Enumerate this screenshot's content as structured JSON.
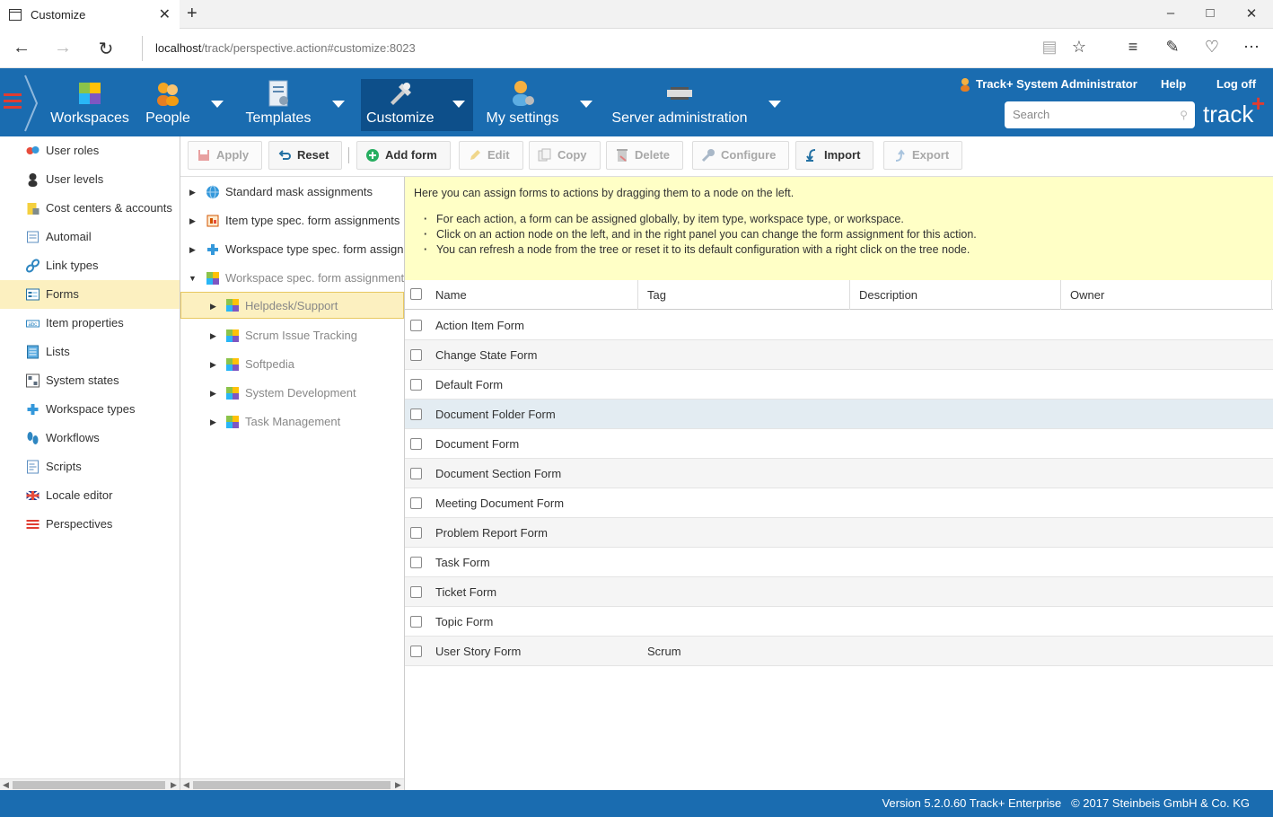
{
  "browser": {
    "tab_title": "Customize",
    "url_host": "localhost",
    "url_path": "/track/perspective.action#customize:8023",
    "new_tab_glyph": "+",
    "close_glyph": "✕"
  },
  "header": {
    "nav": [
      {
        "label": "Workspaces",
        "icon": "workspaces-icon"
      },
      {
        "label": "People",
        "icon": "people-icon"
      },
      {
        "label": "Templates",
        "icon": "templates-icon"
      },
      {
        "label": "Customize",
        "icon": "customize-icon"
      },
      {
        "label": "My settings",
        "icon": "my-settings-icon"
      },
      {
        "label": "Server administration",
        "icon": "server-admin-icon"
      }
    ],
    "user": "Track+ System Administrator",
    "help": "Help",
    "logoff": "Log off",
    "search_placeholder": "Search",
    "logo": "track",
    "logo_plus": "+"
  },
  "sidebar": {
    "items": [
      {
        "label": "User roles",
        "icon": "user-roles-icon",
        "active": false
      },
      {
        "label": "User levels",
        "icon": "user-levels-icon",
        "active": false
      },
      {
        "label": "Cost centers & accounts",
        "icon": "cost-centers-icon",
        "active": false
      },
      {
        "label": "Automail",
        "icon": "automail-icon",
        "active": false
      },
      {
        "label": "Link types",
        "icon": "link-types-icon",
        "active": false
      },
      {
        "label": "Forms",
        "icon": "forms-icon",
        "active": true
      },
      {
        "label": "Item properties",
        "icon": "item-properties-icon",
        "active": false
      },
      {
        "label": "Lists",
        "icon": "lists-icon",
        "active": false
      },
      {
        "label": "System states",
        "icon": "system-states-icon",
        "active": false
      },
      {
        "label": "Workspace types",
        "icon": "workspace-types-icon",
        "active": false
      },
      {
        "label": "Workflows",
        "icon": "workflows-icon",
        "active": false
      },
      {
        "label": "Scripts",
        "icon": "scripts-icon",
        "active": false
      },
      {
        "label": "Locale editor",
        "icon": "locale-editor-icon",
        "active": false
      },
      {
        "label": "Perspectives",
        "icon": "perspectives-icon",
        "active": false
      }
    ]
  },
  "toolbar": {
    "apply": "Apply",
    "reset": "Reset",
    "add_form": "Add form",
    "edit": "Edit",
    "copy": "Copy",
    "delete": "Delete",
    "configure": "Configure",
    "import": "Import",
    "export": "Export"
  },
  "tree": {
    "nodes": [
      {
        "label": "Standard mask assignments",
        "level": 0,
        "expanded": false
      },
      {
        "label": "Item type spec. form assignments",
        "level": 0,
        "expanded": false
      },
      {
        "label": "Workspace type spec. form assignments",
        "level": 0,
        "expanded": false
      },
      {
        "label": "Workspace spec. form assignments",
        "level": 0,
        "expanded": true
      },
      {
        "label": "Helpdesk/Support",
        "level": 1,
        "selected": true
      },
      {
        "label": "Scrum Issue Tracking",
        "level": 1
      },
      {
        "label": "Softpedia",
        "level": 1
      },
      {
        "label": "System Development",
        "level": 1
      },
      {
        "label": "Task Management",
        "level": 1
      }
    ]
  },
  "info": {
    "intro": "Here you can assign forms to actions by dragging them to a node on the left.",
    "bullets": [
      "For each action, a form can be assigned globally, by item type, workspace type, or workspace.",
      "Click on an action node on the left, and in the right panel you can change the form assignment for this action.",
      "You can refresh a node from the tree or reset it to its default configuration with a right click on the tree node."
    ]
  },
  "grid": {
    "columns": [
      "Name",
      "Tag",
      "Description",
      "Owner"
    ],
    "rows": [
      {
        "name": "Action Item Form",
        "tag": ""
      },
      {
        "name": "Change State Form",
        "tag": ""
      },
      {
        "name": "Default Form",
        "tag": ""
      },
      {
        "name": "Document Folder Form",
        "tag": ""
      },
      {
        "name": "Document Form",
        "tag": ""
      },
      {
        "name": "Document Section Form",
        "tag": ""
      },
      {
        "name": "Meeting Document Form",
        "tag": ""
      },
      {
        "name": "Problem Report Form",
        "tag": ""
      },
      {
        "name": "Task Form",
        "tag": ""
      },
      {
        "name": "Ticket Form",
        "tag": ""
      },
      {
        "name": "Topic Form",
        "tag": ""
      },
      {
        "name": "User Story Form",
        "tag": "Scrum"
      }
    ]
  },
  "footer": {
    "text": "Version 5.2.0.60 Track+ Enterprise   © 2017 Steinbeis GmbH & Co. KG"
  },
  "colors": {
    "header_blue": "#1a6cb0",
    "accent_red": "#e03c31",
    "selection_yellow": "#fcf0c0",
    "info_yellow": "#ffffc6"
  }
}
